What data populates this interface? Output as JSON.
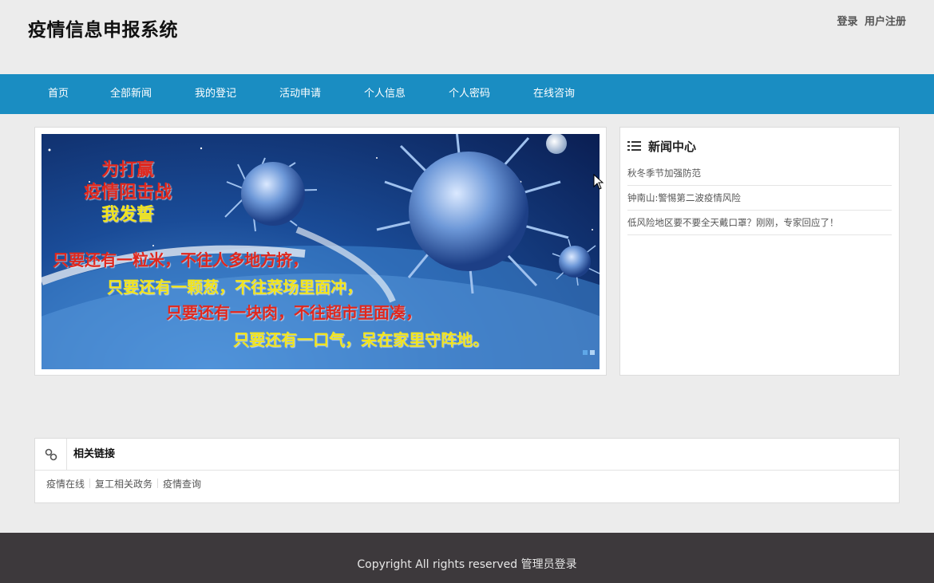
{
  "header": {
    "site_title": "疫情信息申报系统",
    "login": "登录",
    "register": "用户注册"
  },
  "nav": [
    "首页",
    "全部新闻",
    "我的登记",
    "活动申请",
    "个人信息",
    "个人密码",
    "在线咨询"
  ],
  "banner": {
    "title_lines": [
      "为打赢",
      "疫情阻击战",
      "我发誓"
    ],
    "slogans": [
      "只要还有一粒米，不往人多地方挤，",
      "只要还有一颗葱，不往菜场里面冲，",
      "只要还有一块肉，不往超市里面凑，",
      "只要还有一口气，呆在家里守阵地。"
    ],
    "colors": {
      "red": "#e0281e",
      "yellow": "#f2e41c"
    }
  },
  "news": {
    "title": "新闻中心",
    "icon": "list-icon",
    "items": [
      "秋冬季节加强防范",
      "钟南山:警惕第二波疫情风险",
      "低风险地区要不要全天戴口罩？刚刚，专家回应了！"
    ]
  },
  "links": {
    "title": "相关链接",
    "icon": "link-icon",
    "items": [
      "疫情在线",
      "复工相关政务",
      "疫情查询"
    ]
  },
  "footer": {
    "copyright": "Copyright All rights reserved",
    "admin_login": "管理员登录"
  },
  "colors": {
    "nav_bg": "#1a8dc2",
    "footer_bg": "#3d393c",
    "page_bg": "#ececec"
  }
}
